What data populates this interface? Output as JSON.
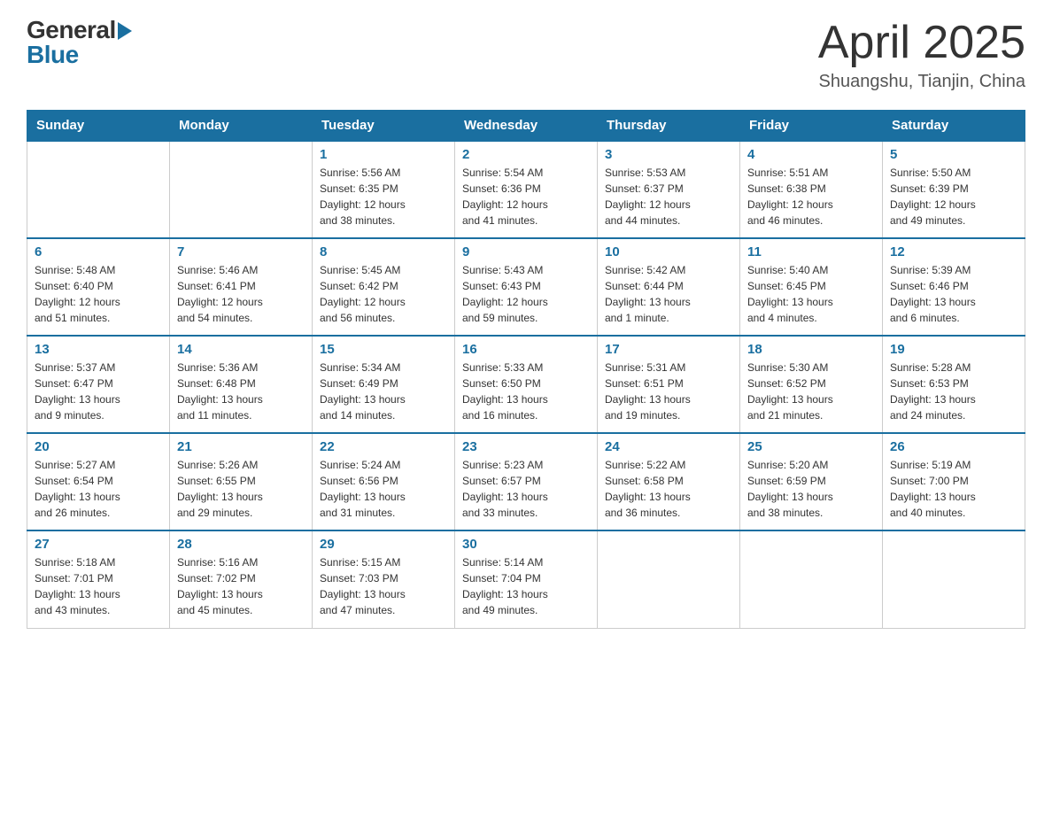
{
  "header": {
    "logo": {
      "general": "General",
      "blue": "Blue"
    },
    "title": "April 2025",
    "location": "Shuangshu, Tianjin, China"
  },
  "calendar": {
    "days_of_week": [
      "Sunday",
      "Monday",
      "Tuesday",
      "Wednesday",
      "Thursday",
      "Friday",
      "Saturday"
    ],
    "weeks": [
      [
        {
          "day": "",
          "info": ""
        },
        {
          "day": "",
          "info": ""
        },
        {
          "day": "1",
          "info": "Sunrise: 5:56 AM\nSunset: 6:35 PM\nDaylight: 12 hours\nand 38 minutes."
        },
        {
          "day": "2",
          "info": "Sunrise: 5:54 AM\nSunset: 6:36 PM\nDaylight: 12 hours\nand 41 minutes."
        },
        {
          "day": "3",
          "info": "Sunrise: 5:53 AM\nSunset: 6:37 PM\nDaylight: 12 hours\nand 44 minutes."
        },
        {
          "day": "4",
          "info": "Sunrise: 5:51 AM\nSunset: 6:38 PM\nDaylight: 12 hours\nand 46 minutes."
        },
        {
          "day": "5",
          "info": "Sunrise: 5:50 AM\nSunset: 6:39 PM\nDaylight: 12 hours\nand 49 minutes."
        }
      ],
      [
        {
          "day": "6",
          "info": "Sunrise: 5:48 AM\nSunset: 6:40 PM\nDaylight: 12 hours\nand 51 minutes."
        },
        {
          "day": "7",
          "info": "Sunrise: 5:46 AM\nSunset: 6:41 PM\nDaylight: 12 hours\nand 54 minutes."
        },
        {
          "day": "8",
          "info": "Sunrise: 5:45 AM\nSunset: 6:42 PM\nDaylight: 12 hours\nand 56 minutes."
        },
        {
          "day": "9",
          "info": "Sunrise: 5:43 AM\nSunset: 6:43 PM\nDaylight: 12 hours\nand 59 minutes."
        },
        {
          "day": "10",
          "info": "Sunrise: 5:42 AM\nSunset: 6:44 PM\nDaylight: 13 hours\nand 1 minute."
        },
        {
          "day": "11",
          "info": "Sunrise: 5:40 AM\nSunset: 6:45 PM\nDaylight: 13 hours\nand 4 minutes."
        },
        {
          "day": "12",
          "info": "Sunrise: 5:39 AM\nSunset: 6:46 PM\nDaylight: 13 hours\nand 6 minutes."
        }
      ],
      [
        {
          "day": "13",
          "info": "Sunrise: 5:37 AM\nSunset: 6:47 PM\nDaylight: 13 hours\nand 9 minutes."
        },
        {
          "day": "14",
          "info": "Sunrise: 5:36 AM\nSunset: 6:48 PM\nDaylight: 13 hours\nand 11 minutes."
        },
        {
          "day": "15",
          "info": "Sunrise: 5:34 AM\nSunset: 6:49 PM\nDaylight: 13 hours\nand 14 minutes."
        },
        {
          "day": "16",
          "info": "Sunrise: 5:33 AM\nSunset: 6:50 PM\nDaylight: 13 hours\nand 16 minutes."
        },
        {
          "day": "17",
          "info": "Sunrise: 5:31 AM\nSunset: 6:51 PM\nDaylight: 13 hours\nand 19 minutes."
        },
        {
          "day": "18",
          "info": "Sunrise: 5:30 AM\nSunset: 6:52 PM\nDaylight: 13 hours\nand 21 minutes."
        },
        {
          "day": "19",
          "info": "Sunrise: 5:28 AM\nSunset: 6:53 PM\nDaylight: 13 hours\nand 24 minutes."
        }
      ],
      [
        {
          "day": "20",
          "info": "Sunrise: 5:27 AM\nSunset: 6:54 PM\nDaylight: 13 hours\nand 26 minutes."
        },
        {
          "day": "21",
          "info": "Sunrise: 5:26 AM\nSunset: 6:55 PM\nDaylight: 13 hours\nand 29 minutes."
        },
        {
          "day": "22",
          "info": "Sunrise: 5:24 AM\nSunset: 6:56 PM\nDaylight: 13 hours\nand 31 minutes."
        },
        {
          "day": "23",
          "info": "Sunrise: 5:23 AM\nSunset: 6:57 PM\nDaylight: 13 hours\nand 33 minutes."
        },
        {
          "day": "24",
          "info": "Sunrise: 5:22 AM\nSunset: 6:58 PM\nDaylight: 13 hours\nand 36 minutes."
        },
        {
          "day": "25",
          "info": "Sunrise: 5:20 AM\nSunset: 6:59 PM\nDaylight: 13 hours\nand 38 minutes."
        },
        {
          "day": "26",
          "info": "Sunrise: 5:19 AM\nSunset: 7:00 PM\nDaylight: 13 hours\nand 40 minutes."
        }
      ],
      [
        {
          "day": "27",
          "info": "Sunrise: 5:18 AM\nSunset: 7:01 PM\nDaylight: 13 hours\nand 43 minutes."
        },
        {
          "day": "28",
          "info": "Sunrise: 5:16 AM\nSunset: 7:02 PM\nDaylight: 13 hours\nand 45 minutes."
        },
        {
          "day": "29",
          "info": "Sunrise: 5:15 AM\nSunset: 7:03 PM\nDaylight: 13 hours\nand 47 minutes."
        },
        {
          "day": "30",
          "info": "Sunrise: 5:14 AM\nSunset: 7:04 PM\nDaylight: 13 hours\nand 49 minutes."
        },
        {
          "day": "",
          "info": ""
        },
        {
          "day": "",
          "info": ""
        },
        {
          "day": "",
          "info": ""
        }
      ]
    ]
  }
}
